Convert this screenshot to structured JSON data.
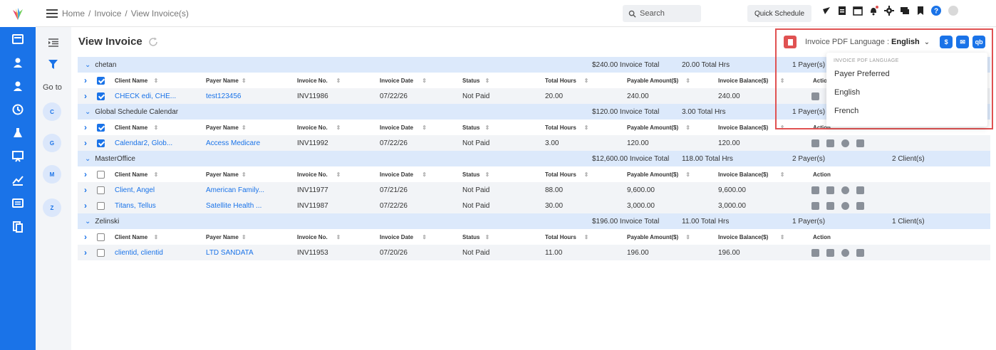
{
  "breadcrumb": [
    "Home",
    "/",
    "Invoice",
    "/",
    "View Invoice(s)"
  ],
  "search": {
    "label": "Search"
  },
  "quick_schedule": "Quick Schedule",
  "goto_label": "Go to",
  "letters": [
    "C",
    "G",
    "M",
    "Z"
  ],
  "page_title": "View Invoice",
  "pdf_language": {
    "label": "Invoice PDF Language :",
    "value": "English"
  },
  "dropdown": {
    "header": "INVOICE PDF LANGUAGE",
    "options": [
      "Payer Preferred",
      "English",
      "French"
    ]
  },
  "columns": [
    "Client Name",
    "Payer Name",
    "Invoice No.",
    "Invoice Date",
    "Status",
    "Total Hours",
    "Payable Amount($)",
    "Invoice Balance($)",
    "Action"
  ],
  "groups": [
    {
      "name": "chetan",
      "invoice_total": "$240.00 Invoice Total",
      "total_hrs": "20.00 Total Hrs",
      "payers": "1 Payer(s)",
      "clients": "",
      "rows": [
        {
          "client": "CHECK edi, CHE...",
          "payer": "test123456",
          "invoice_no": "INV11986",
          "date": "07/22/26",
          "status": "Not Paid",
          "hours": "20.00",
          "payable": "240.00",
          "balance": "240.00",
          "checked": true
        }
      ]
    },
    {
      "name": "Global Schedule Calendar",
      "invoice_total": "$120.00 Invoice Total",
      "total_hrs": "3.00 Total Hrs",
      "payers": "1 Payer(s)",
      "clients": "",
      "rows": [
        {
          "client": "Calendar2, Glob...",
          "payer": "Access Medicare",
          "invoice_no": "INV11992",
          "date": "07/22/26",
          "status": "Not Paid",
          "hours": "3.00",
          "payable": "120.00",
          "balance": "120.00",
          "checked": true
        }
      ]
    },
    {
      "name": "MasterOffice",
      "invoice_total": "$12,600.00 Invoice Total",
      "total_hrs": "118.00 Total Hrs",
      "payers": "2 Payer(s)",
      "clients": "2 Client(s)",
      "rows": [
        {
          "client": "Client, Angel",
          "payer": "American Family...",
          "invoice_no": "INV11977",
          "date": "07/21/26",
          "status": "Not Paid",
          "hours": "88.00",
          "payable": "9,600.00",
          "balance": "9,600.00",
          "checked": false
        },
        {
          "client": "Titans, Tellus",
          "payer": "Satellite Health ...",
          "invoice_no": "INV11987",
          "date": "07/22/26",
          "status": "Not Paid",
          "hours": "30.00",
          "payable": "3,000.00",
          "balance": "3,000.00",
          "checked": false
        }
      ]
    },
    {
      "name": "Zelinski",
      "invoice_total": "$196.00 Invoice Total",
      "total_hrs": "11.00 Total Hrs",
      "payers": "1 Payer(s)",
      "clients": "1 Client(s)",
      "rows": [
        {
          "client": "clientid, clientid",
          "payer": "LTD SANDATA",
          "invoice_no": "INV11953",
          "date": "07/20/26",
          "status": "Not Paid",
          "hours": "11.00",
          "payable": "196.00",
          "balance": "196.00",
          "checked": false
        }
      ]
    }
  ],
  "colors": {
    "primary": "#1a73e8",
    "highlight": "#e05252",
    "group_bg": "#dce9fb"
  }
}
